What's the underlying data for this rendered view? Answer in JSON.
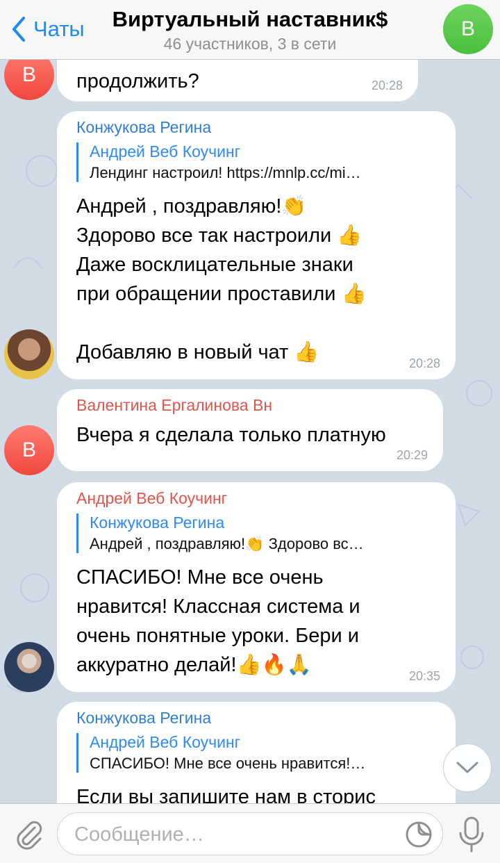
{
  "header": {
    "back_label": "Чаты",
    "title": "Виртуальный наставник$",
    "subtitle": "46 участников, 3 в сети",
    "avatar_letter": "В"
  },
  "messages": [
    {
      "avatar_letter": "В",
      "text": "продолжить?",
      "time": "20:28"
    },
    {
      "sender": "Конжукова Регина",
      "reply_name": "Андрей Веб Коучинг",
      "reply_text": "Лендинг настроил! https://mnlp.cc/mi…",
      "lines": [
        "Андрей , поздравляю!👏",
        "Здорово все так настроили 👍",
        "Даже восклицательные знаки",
        "при обращении проставили 👍",
        "",
        "Добавляю в новый чат 👍"
      ],
      "time": "20:28"
    },
    {
      "sender": "Валентина Ергалинова Вн",
      "avatar_letter": "В",
      "text": "Вчера я сделала только платную",
      "time": "20:29"
    },
    {
      "sender": "Андрей Веб Коучинг",
      "reply_name": "Конжукова Регина",
      "reply_text": "Андрей , поздравляю!👏 Здорово вс…",
      "lines": [
        "СПАСИБО! Мне все  очень",
        "нравится! Классная система и",
        "очень понятные уроки. Бери и",
        "аккуратно делай!👍🔥🙏"
      ],
      "time": "20:35"
    },
    {
      "sender": "Конжукова Регина",
      "reply_name": "Андрей Веб Коучинг",
      "reply_text": "СПАСИБО! Мне все  очень нравится!…",
      "lines": [
        "Если вы запишите нам в сторис"
      ]
    }
  ],
  "input": {
    "placeholder": "Сообщение…"
  },
  "colors": {
    "accent": "#1d8bf1",
    "chat_bg": "#d2dce6",
    "red_name": "#e0564c",
    "blue_name": "#2f7fd4"
  }
}
